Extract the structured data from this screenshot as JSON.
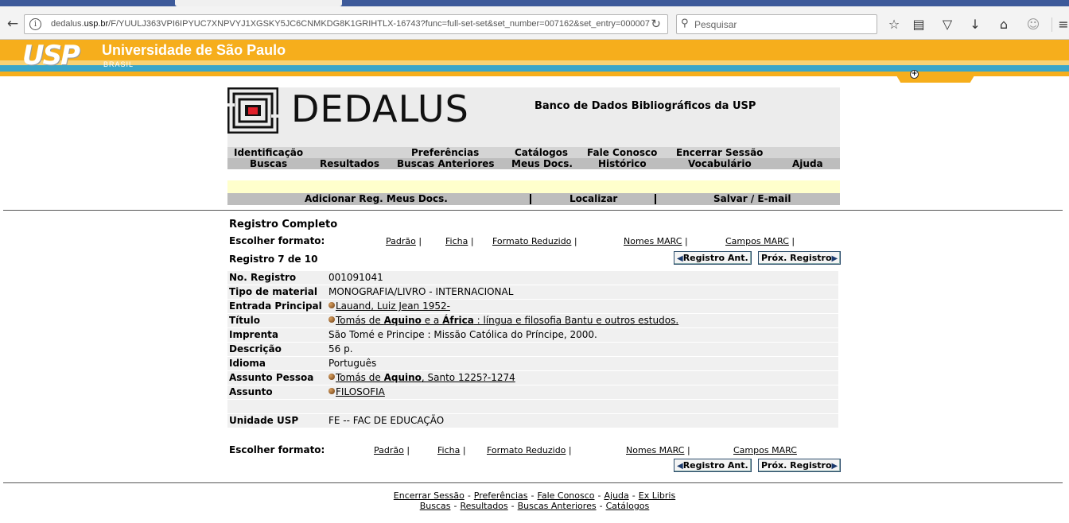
{
  "browser": {
    "url_prefix": "dedalus.",
    "url_domain": "usp.br",
    "url_rest": "/F/YUULJ363VPI6IPYUC7XNPVYJ1XGSKY5JC6CNMKDG8K1GRIHTLX-16743?func=full-set-set&set_number=007162&set_entry=000007",
    "search_placeholder": "Pesquisar",
    "icons": [
      "back-icon",
      "info-icon",
      "reload-icon",
      "search-icon",
      "bookmark-star-icon",
      "reading-list-icon",
      "pocket-icon",
      "download-icon",
      "home-icon",
      "account-icon",
      "menu-icon"
    ]
  },
  "banner": {
    "logo_text": "USP",
    "university": "Universidade de São Paulo",
    "country": "BRASIL"
  },
  "dedalus": {
    "name": "DEDALUS",
    "tagline": "Banco de Dados Bibliográficos da USP"
  },
  "menu": {
    "row1": [
      "Identificação",
      "Preferências",
      "Catálogos",
      "Fale Conosco",
      "Encerrar Sessão"
    ],
    "row2": [
      "Buscas",
      "Resultados",
      "Buscas Anteriores",
      "Meus Docs.",
      "Histórico",
      "Vocabulário",
      "Ajuda"
    ]
  },
  "actions": [
    "Adicionar Reg. Meus Docs.",
    "Localizar",
    "Salvar / E-mail"
  ],
  "record": {
    "title": "Registro Completo",
    "choose_format": "Escolher formato:",
    "formats": [
      "Padrão",
      "Ficha",
      "Formato Reduzido",
      "Nomes MARC",
      "Campos MARC"
    ],
    "count": "Registro 7 de 10",
    "prev": "Registro Ant.",
    "next": "Próx. Registro",
    "fields": {
      "no_registro_label": "No. Registro",
      "no_registro": "001091041",
      "tipo_label": "Tipo de material",
      "tipo": "MONOGRAFIA/LIVRO - INTERNACIONAL",
      "entrada_label": "Entrada Principal",
      "entrada": "Lauand, Luiz Jean 1952-",
      "titulo_label": "Título",
      "titulo_a": "Tomás de ",
      "titulo_b": "Aquino",
      "titulo_c": " e a ",
      "titulo_d": "África",
      "titulo_e": " : língua e filosofia Bantu e outros estudos.",
      "imprenta_label": "Imprenta",
      "imprenta": "São Tomé e Principe : Missão Católica do Príncipe, 2000.",
      "descricao_label": "Descrição",
      "descricao": "56 p.",
      "idioma_label": "Idioma",
      "idioma": "Português",
      "assunto_pessoa_label": "Assunto Pessoa",
      "assunto_pessoa_a": "Tomás de ",
      "assunto_pessoa_b": "Aquino",
      "assunto_pessoa_c": ", Santo 1225?-1274",
      "assunto_label": "Assunto",
      "assunto": "FILOSOFIA",
      "unidade_label": "Unidade USP",
      "unidade": "FE -- FAC DE EDUCAÇÃO"
    }
  },
  "footer": {
    "line1": [
      "Encerrar Sessão",
      "Preferências",
      "Fale Conosco",
      "Ajuda",
      "Ex Libris"
    ],
    "line2": [
      "Buscas",
      "Resultados",
      "Buscas Anteriores",
      "Catálogos"
    ],
    "separator": "-"
  }
}
